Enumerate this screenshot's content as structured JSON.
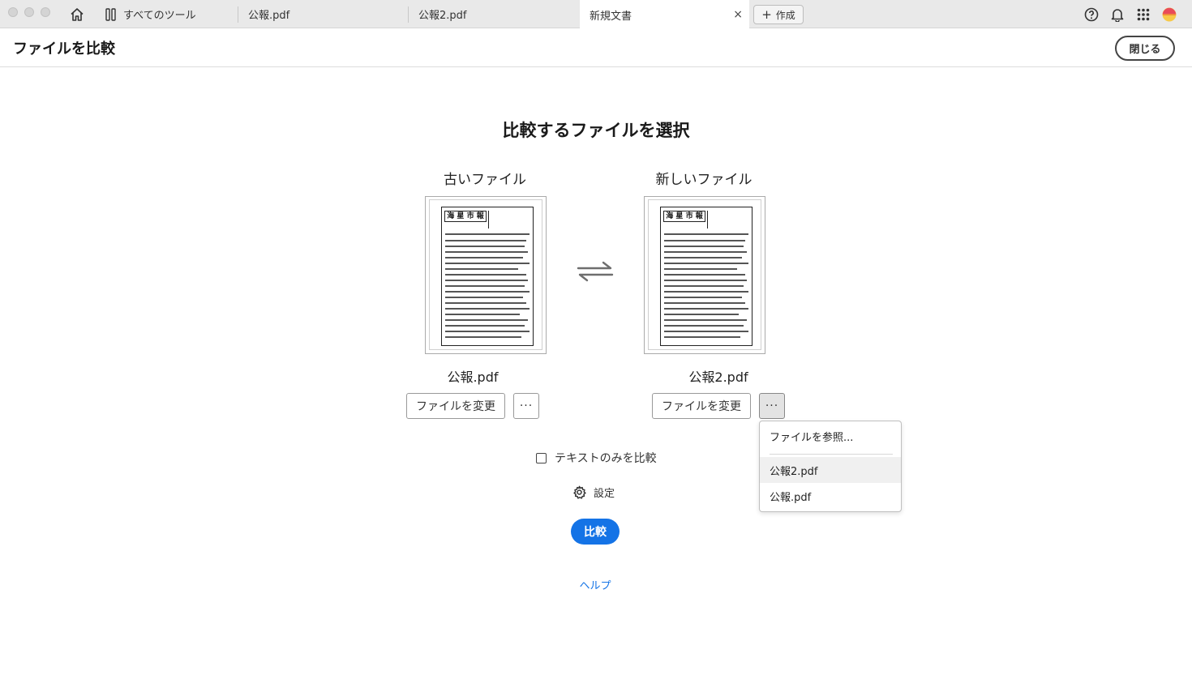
{
  "window": {
    "tabs": [
      {
        "label": "すべてのツール",
        "icon": "tools-icon"
      },
      {
        "label": "公報.pdf"
      },
      {
        "label": "公報2.pdf"
      },
      {
        "label": "新規文書",
        "active": true,
        "close": "×"
      }
    ],
    "create_label": "作成",
    "icons": [
      "home-icon",
      "help-icon",
      "bell-icon",
      "apps-grid-icon",
      "avatar"
    ]
  },
  "header": {
    "title": "ファイルを比較",
    "close_label": "閉じる"
  },
  "main": {
    "title": "比較するファイルを選択",
    "old_file": {
      "heading": "古いファイル",
      "filename": "公報.pdf",
      "change_label": "ファイルを変更",
      "more_label": "···",
      "thumbnail_title": "海 星 市 報"
    },
    "new_file": {
      "heading": "新しいファイル",
      "filename": "公報2.pdf",
      "change_label": "ファイルを変更",
      "more_label": "···",
      "thumbnail_title": "海 星 市 報"
    },
    "dropdown": {
      "browse_label": "ファイルを参照...",
      "recent": [
        "公報2.pdf",
        "公報.pdf"
      ]
    },
    "text_only_label": "テキストのみを比較",
    "text_only_checked": false,
    "settings_label": "設定",
    "compare_label": "比較",
    "help_label": "ヘルプ"
  },
  "colors": {
    "accent": "#1473e6",
    "titlebar": "#e9e9e9"
  }
}
